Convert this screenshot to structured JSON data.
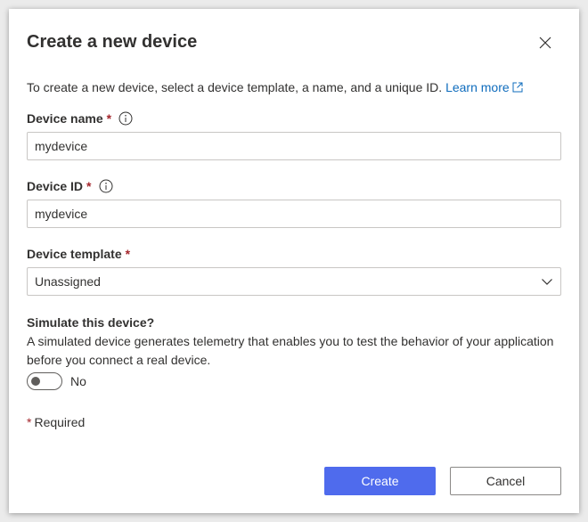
{
  "dialog": {
    "title": "Create a new device",
    "description": "To create a new device, select a device template, a name, and a unique ID.",
    "learn_more": "Learn more"
  },
  "fields": {
    "device_name": {
      "label": "Device name",
      "value": "mydevice"
    },
    "device_id": {
      "label": "Device ID",
      "value": "mydevice"
    },
    "device_template": {
      "label": "Device template",
      "value": "Unassigned"
    }
  },
  "required_marker": "*",
  "simulate": {
    "title": "Simulate this device?",
    "description": "A simulated device generates telemetry that enables you to test the behavior of your application before you connect a real device.",
    "toggle_state": "No",
    "toggle_on": false
  },
  "required_note": "Required",
  "buttons": {
    "create": "Create",
    "cancel": "Cancel"
  },
  "colors": {
    "accent": "#4f6bed",
    "link": "#0f6cbd",
    "required": "#a4262c"
  },
  "icons": {
    "close": "close-icon",
    "info": "info-icon",
    "external_link": "external-link-icon",
    "chevron": "chevron-down-icon"
  }
}
